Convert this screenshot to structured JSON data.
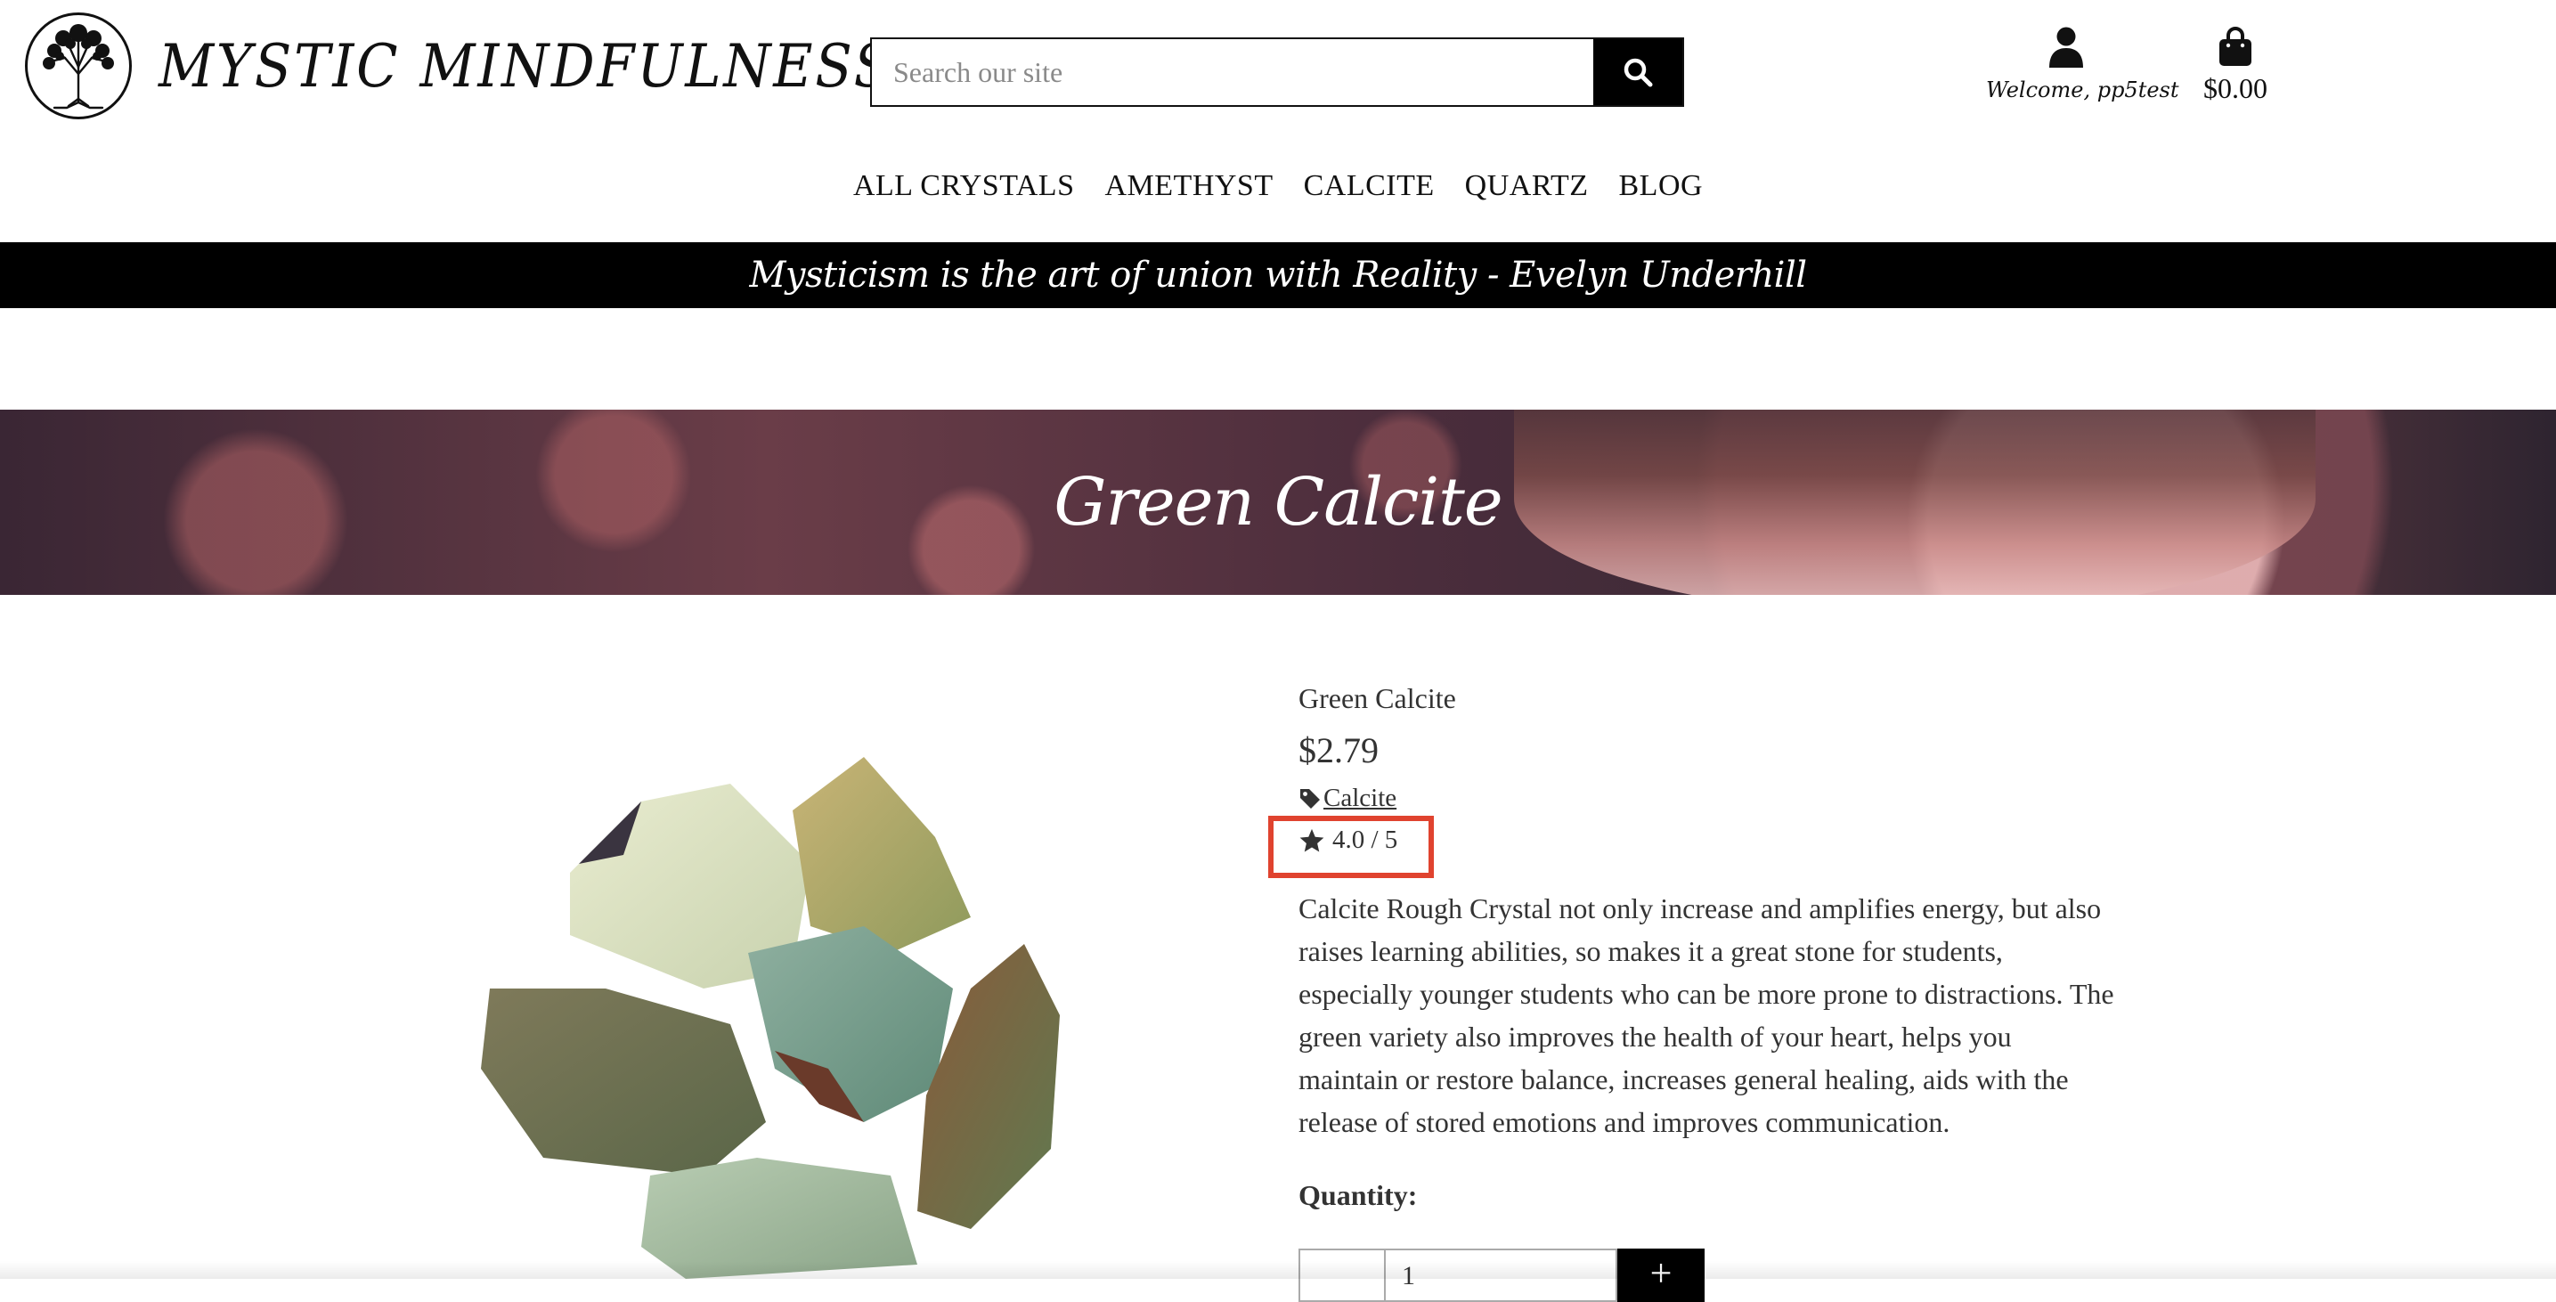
{
  "brand": {
    "name": "MYSTIC MINDFULNESS",
    "logo_icon": "tree-of-life-icon"
  },
  "search": {
    "placeholder": "Search our site",
    "icon": "search-icon"
  },
  "account": {
    "label": "Welcome, pp5test",
    "icon": "user-icon"
  },
  "bag": {
    "total": "$0.00",
    "icon": "shopping-bag-icon"
  },
  "nav": {
    "items": [
      "ALL CRYSTALS",
      "AMETHYST",
      "CALCITE",
      "QUARTZ",
      "BLOG"
    ]
  },
  "quote": "Mysticism is the art of union with Reality - Evelyn Underhill",
  "hero": {
    "title": "Green Calcite"
  },
  "product": {
    "name": "Green Calcite",
    "price": "$2.79",
    "category": "Calcite",
    "rating": "4.0 / 5",
    "description": "Calcite Rough Crystal not only increase and amplifies energy, but also raises learning abilities, so makes it a great stone for students, especially younger students who can be more prone to distractions. The green variety also improves the health of your heart, helps you maintain or restore balance, increases general healing, aids with the release of stored emotions and improves communication.",
    "quantity_label": "Quantity:",
    "quantity_value": "1",
    "plus_label": "+"
  },
  "colors": {
    "highlight": "#e0432f",
    "bar": "#000000",
    "accent": "#000000"
  }
}
